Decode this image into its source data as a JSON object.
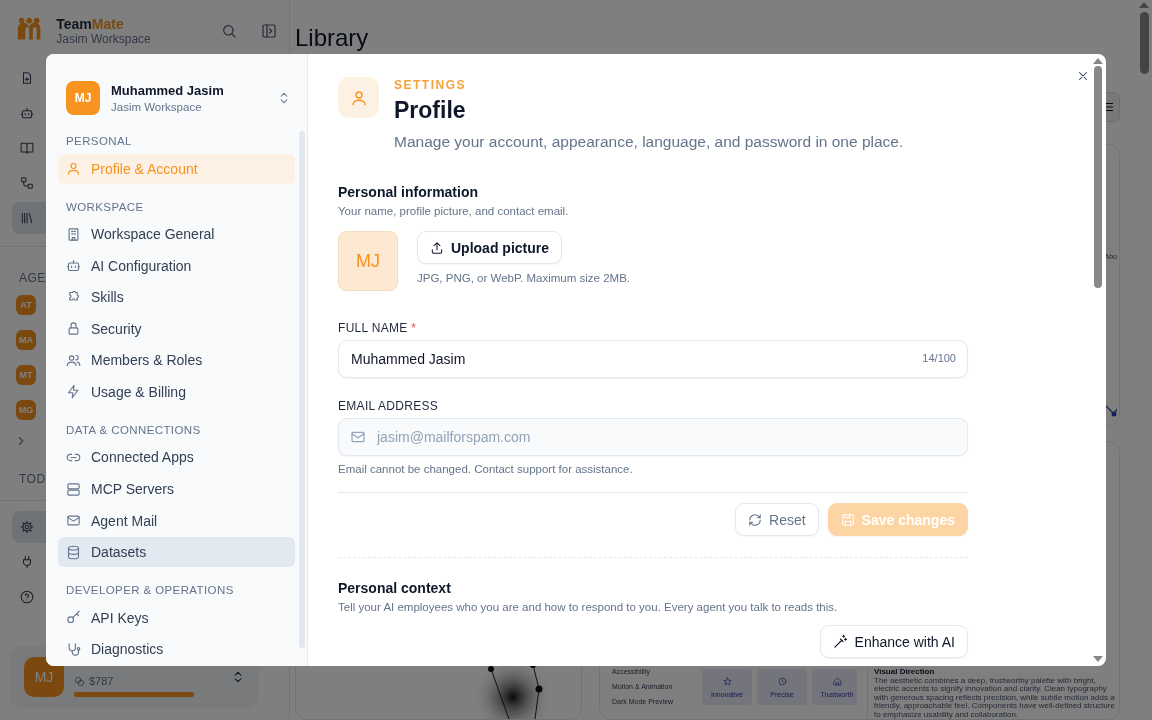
{
  "background": {
    "brand": {
      "name_part_1": "Team",
      "name_part_2": "Mate",
      "workspace": "Jasim Workspace"
    },
    "nav": [
      {
        "selected": false
      },
      {
        "selected": false
      },
      {
        "selected": false
      },
      {
        "selected": false
      },
      {
        "selected": true
      }
    ],
    "agents_heading": "AGE",
    "agents": [
      {
        "initials": "AT"
      },
      {
        "initials": "MA"
      },
      {
        "initials": "MT"
      },
      {
        "initials": "MG"
      }
    ],
    "today_heading": "TOD",
    "footer_nav": [
      {
        "selected": true
      },
      {
        "selected": false
      },
      {
        "selected": false
      }
    ],
    "user": {
      "initials": "MJ",
      "credits": "$787",
      "level": 1
    },
    "page_title": "Library",
    "card_label": "Abo",
    "style_rows": [
      "Accessibility",
      "Motion & Animation",
      "Dark Mode Preview"
    ],
    "tiles": [
      {
        "label": "Innovative"
      },
      {
        "label": "Precise"
      },
      {
        "label": "Trustworth"
      }
    ],
    "visual_direction": {
      "title": "Visual Direction",
      "text": "The aesthetic combines a deep, trustworthy palette with bright, electric accents to signify innovation and clarity. Clean typography with generous spacing reflects precision, while subtle motion adds a friendly, approachable feel. Components have well-defined structure to emphasize usability and collaboration."
    }
  },
  "modal": {
    "account": {
      "initials": "MJ",
      "name": "Muhammed Jasim",
      "workspace": "Jasim Workspace"
    },
    "sections": [
      {
        "heading": "PERSONAL",
        "items": [
          {
            "label": "Profile & Account",
            "selected": true,
            "hovered": false
          }
        ]
      },
      {
        "heading": "WORKSPACE",
        "items": [
          {
            "label": "Workspace General",
            "selected": false,
            "hovered": false
          },
          {
            "label": "AI Configuration",
            "selected": false,
            "hovered": false
          },
          {
            "label": "Skills",
            "selected": false,
            "hovered": false
          },
          {
            "label": "Security",
            "selected": false,
            "hovered": false
          },
          {
            "label": "Members & Roles",
            "selected": false,
            "hovered": false
          },
          {
            "label": "Usage & Billing",
            "selected": false,
            "hovered": false
          }
        ]
      },
      {
        "heading": "DATA & CONNECTIONS",
        "items": [
          {
            "label": "Connected Apps",
            "selected": false,
            "hovered": false
          },
          {
            "label": "MCP Servers",
            "selected": false,
            "hovered": false
          },
          {
            "label": "Agent Mail",
            "selected": false,
            "hovered": false
          },
          {
            "label": "Datasets",
            "selected": false,
            "hovered": true
          }
        ]
      },
      {
        "heading": "DEVELOPER & OPERATIONS",
        "items": [
          {
            "label": "API Keys",
            "selected": false,
            "hovered": false
          },
          {
            "label": "Diagnostics",
            "selected": false,
            "hovered": false
          }
        ]
      }
    ],
    "header": {
      "eyebrow": "SETTINGS",
      "title": "Profile",
      "subtitle": "Manage your account, appearance, language, and password in one place."
    },
    "personal_info": {
      "title": "Personal information",
      "subtitle": "Your name, profile picture, and contact email.",
      "avatar_initials": "MJ",
      "upload_button": "Upload picture",
      "upload_hint": "JPG, PNG, or WebP. Maximum size 2MB."
    },
    "full_name": {
      "label": "FULL NAME",
      "required_mark": "*",
      "value": "Muhammed Jasim",
      "counter": "14/100"
    },
    "email": {
      "label": "EMAIL ADDRESS",
      "value": "jasim@mailforspam.com",
      "disabled": true,
      "hint": "Email cannot be changed. Contact support for assistance."
    },
    "actions": [
      {
        "label": "Reset",
        "kind": "secondary",
        "disabled": false
      },
      {
        "label": "Save changes",
        "kind": "primary",
        "disabled": true
      }
    ],
    "personal_context": {
      "title": "Personal context",
      "subtitle": "Tell your AI employees who you are and how to respond to you. Every agent you talk to reads this.",
      "enhance_button": "Enhance with AI"
    }
  }
}
